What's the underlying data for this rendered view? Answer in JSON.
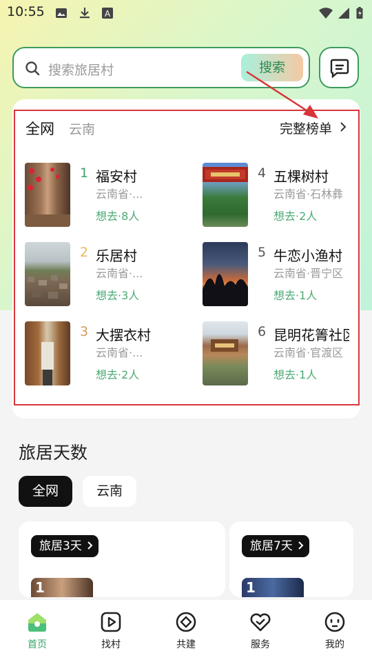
{
  "status_bar": {
    "time": "10:55"
  },
  "search": {
    "placeholder": "搜索旅居村",
    "button": "搜索"
  },
  "ranking": {
    "tabs": [
      "全网",
      "云南"
    ],
    "full_list_link": "完整榜单",
    "items": [
      {
        "rank": "1",
        "name": "福安村",
        "location": "云南省·...",
        "want": "想去·8人",
        "rank_color": "#3aa56a"
      },
      {
        "rank": "2",
        "name": "乐居村",
        "location": "云南省·...",
        "want": "想去·3人",
        "rank_color": "#e6b85a"
      },
      {
        "rank": "3",
        "name": "大摆衣村",
        "location": "云南省·...",
        "want": "想去·2人",
        "rank_color": "#d69a5a"
      },
      {
        "rank": "4",
        "name": "五棵树村",
        "location": "云南省·石林彝",
        "want": "想去·2人",
        "rank_color": "#555555"
      },
      {
        "rank": "5",
        "name": "牛恋小渔村",
        "location": "云南省·晋宁区",
        "want": "想去·1人",
        "rank_color": "#555555"
      },
      {
        "rank": "6",
        "name": "昆明花箐社区",
        "location": "云南省·官渡区",
        "want": "想去·1人",
        "rank_color": "#555555"
      }
    ]
  },
  "days_section": {
    "title": "旅居天数",
    "chips": [
      "全网",
      "云南"
    ],
    "cards": [
      {
        "tag": "旅居3天",
        "rank": "1"
      },
      {
        "tag": "旅居7天",
        "rank": "1"
      }
    ]
  },
  "bottom_nav": {
    "items": [
      {
        "label": "首页",
        "icon": "home-icon",
        "active": true
      },
      {
        "label": "找村",
        "icon": "play-square-icon",
        "active": false
      },
      {
        "label": "共建",
        "icon": "diamond-icon",
        "active": false
      },
      {
        "label": "服务",
        "icon": "heart-handshake-icon",
        "active": false
      },
      {
        "label": "我的",
        "icon": "face-icon",
        "active": false
      }
    ]
  },
  "colors": {
    "accent": "#3aa56a",
    "border": "#3c9a5e",
    "highlight": "#d8343a"
  }
}
